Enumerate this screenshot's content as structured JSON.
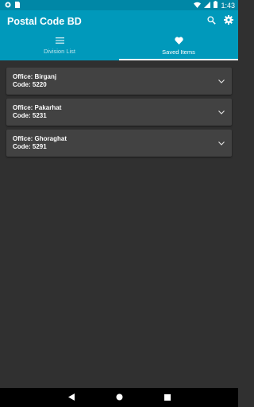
{
  "status_bar": {
    "time": "1:43",
    "left_icons": [
      "app-notification-icon",
      "sim-card-icon"
    ],
    "right_icons": [
      "wifi-icon",
      "signal-icon",
      "battery-icon"
    ]
  },
  "app_bar": {
    "title": "Postal Code BD",
    "actions": [
      "search-icon",
      "settings-icon"
    ]
  },
  "tabs": [
    {
      "label": "Division List",
      "icon": "list-icon",
      "selected": false
    },
    {
      "label": "Saved Items",
      "icon": "heart-icon",
      "selected": true
    }
  ],
  "saved_items": [
    {
      "office": "Office: Birganj",
      "code": "Code: 5220"
    },
    {
      "office": "Office: Pakarhat",
      "code": "Code: 5231"
    },
    {
      "office": "Office: Ghoraghat",
      "code": "Code: 5291"
    }
  ],
  "nav_bar": [
    "back-icon",
    "home-icon",
    "recents-icon"
  ],
  "colors": {
    "status_bar": "#0087a6",
    "app_bar": "#0099bb",
    "background": "#303030",
    "card": "#424242"
  }
}
